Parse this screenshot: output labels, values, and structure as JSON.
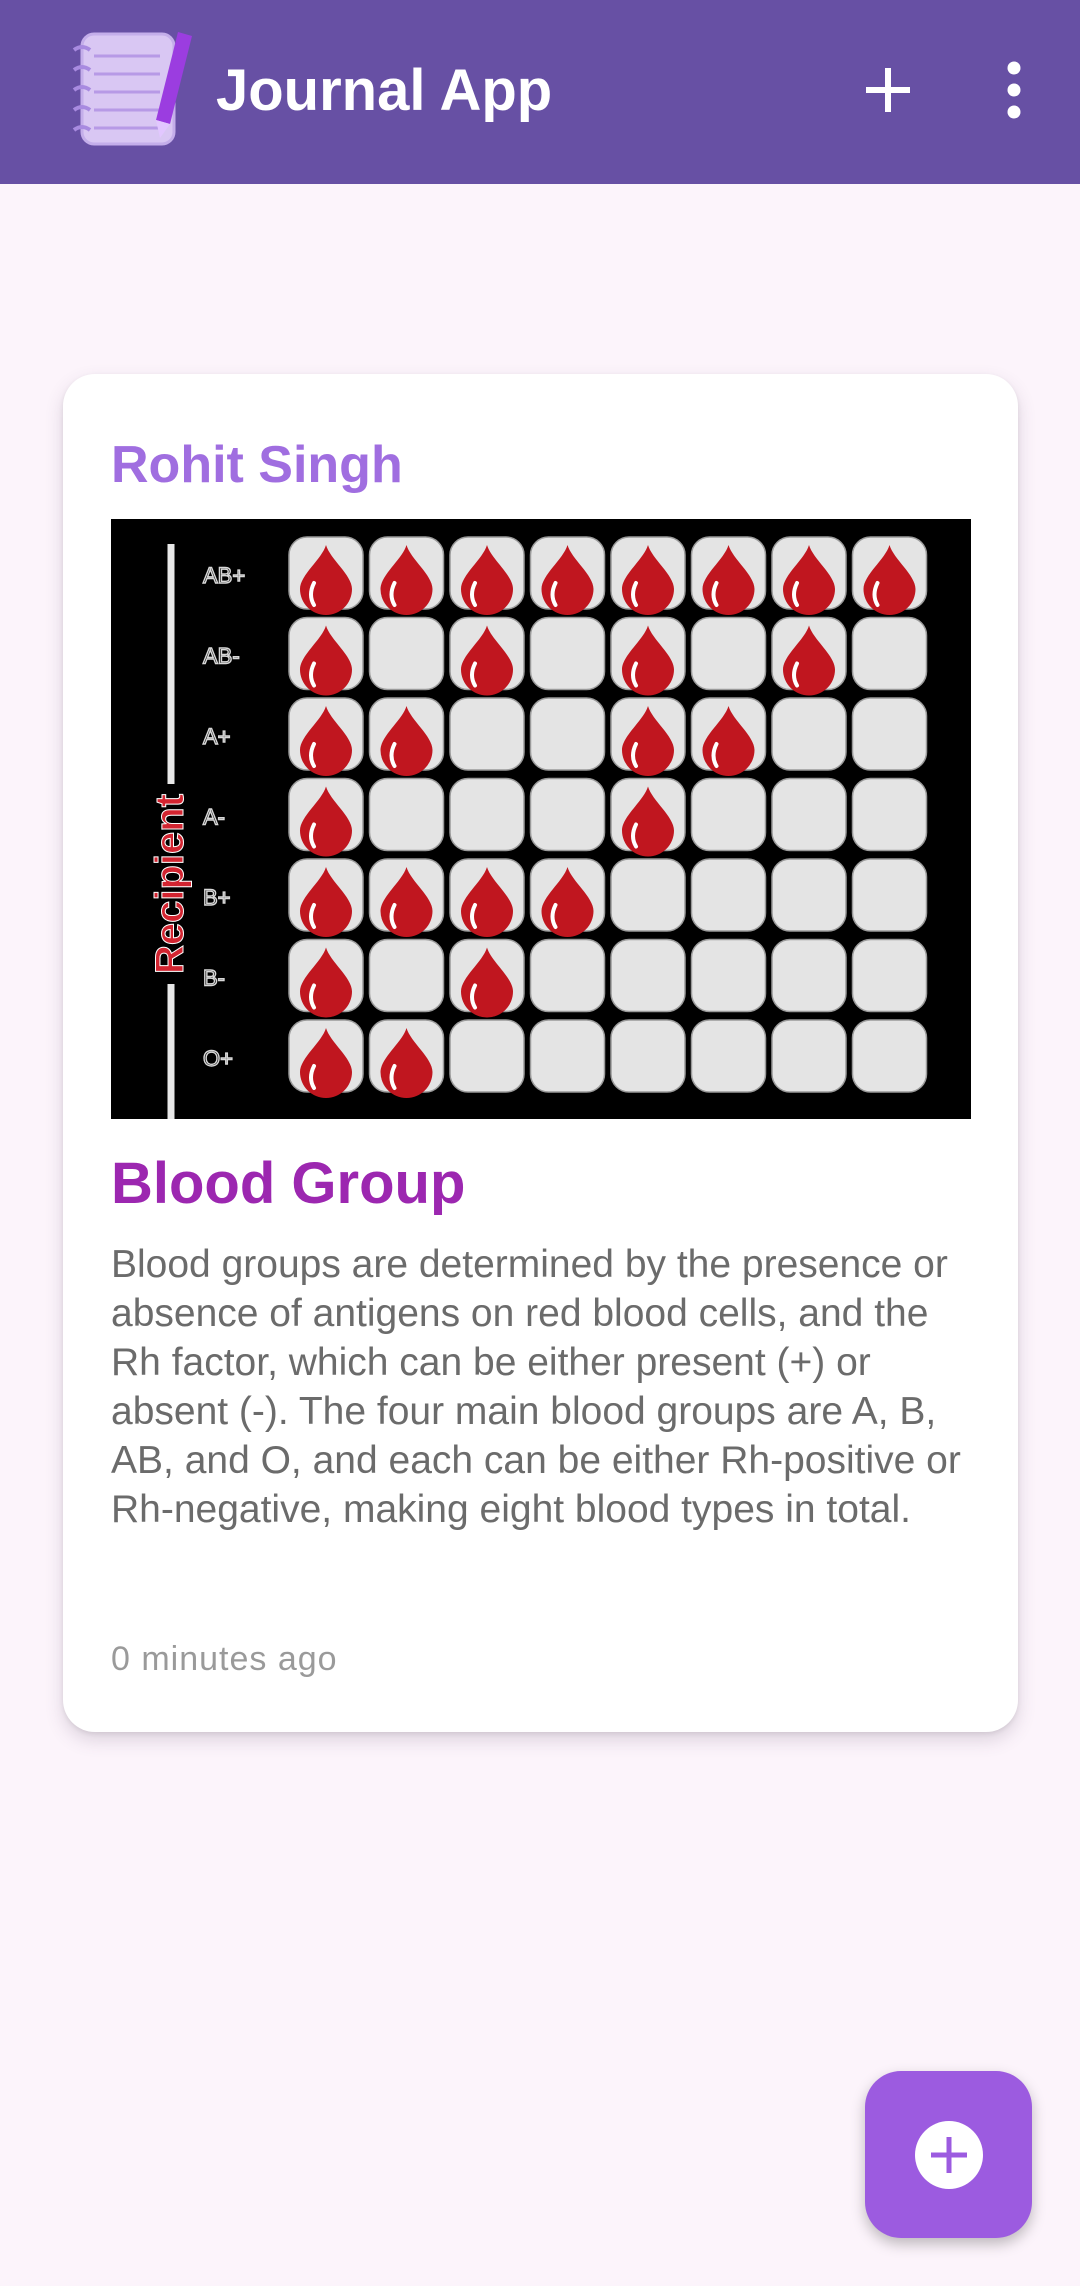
{
  "app_bar": {
    "title": "Journal App",
    "actions": [
      {
        "icon": "plus-icon"
      },
      {
        "icon": "more-vertical-icon"
      }
    ]
  },
  "entries": [
    {
      "author": "Rohit Singh",
      "image": {
        "vertical_label": "Recipient",
        "row_labels": [
          "AB+",
          "AB-",
          "A+",
          "A-",
          "B+",
          "B-",
          "O+"
        ],
        "grid": [
          [
            1,
            1,
            1,
            1,
            1,
            1,
            1,
            1
          ],
          [
            1,
            0,
            1,
            0,
            1,
            0,
            1,
            0
          ],
          [
            1,
            1,
            0,
            0,
            1,
            1,
            0,
            0
          ],
          [
            1,
            0,
            0,
            0,
            1,
            0,
            0,
            0
          ],
          [
            1,
            1,
            1,
            1,
            0,
            0,
            0,
            0
          ],
          [
            1,
            0,
            1,
            0,
            0,
            0,
            0,
            0
          ],
          [
            1,
            1,
            0,
            0,
            0,
            0,
            0,
            0
          ]
        ]
      },
      "title": "Blood Group",
      "body": "Blood groups are determined by the presence or absence of antigens on red blood cells, and the Rh factor, which can be either present (+) or absent (-). The four main blood groups are A, B, AB, and O, and each can be either Rh-positive or Rh-negative, making eight blood types in total.",
      "timestamp": "0 minutes ago"
    }
  ],
  "fab": {
    "icon": "add-circle-icon"
  },
  "colors": {
    "app_bar": "#6750a4",
    "background": "#fcf4fb",
    "author": "#a06ee0",
    "title": "#9c27b0",
    "fab": "#9c5be0",
    "blood": "#c0161f"
  }
}
